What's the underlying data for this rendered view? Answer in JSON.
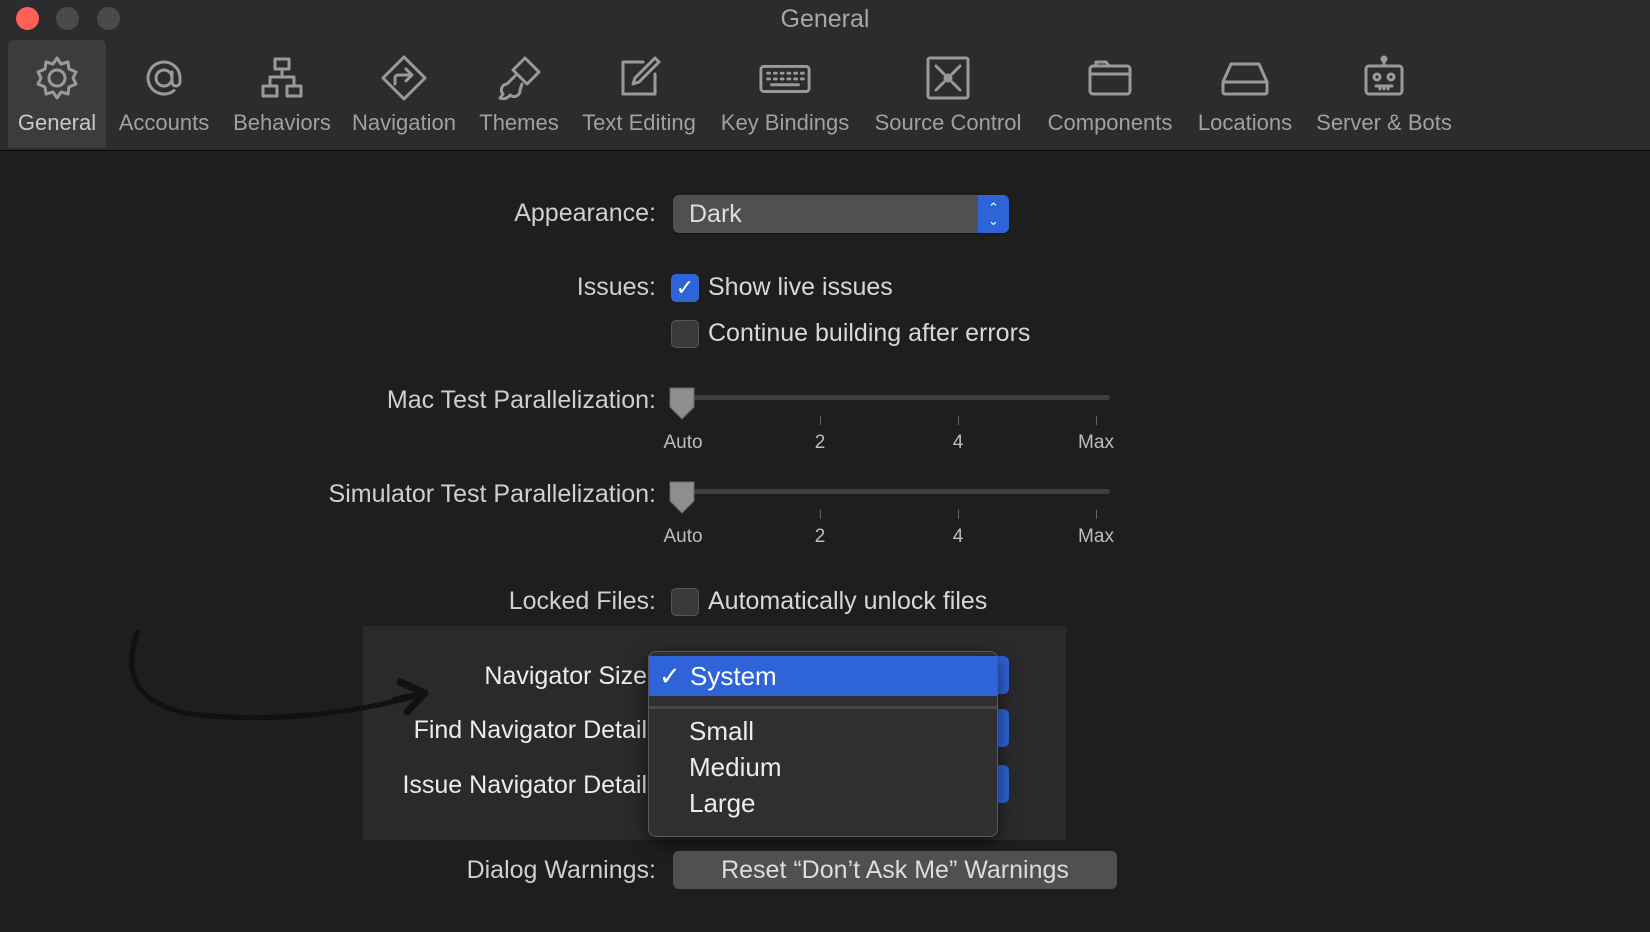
{
  "window": {
    "title": "General"
  },
  "toolbar": [
    {
      "label": "General",
      "icon": "gear-icon"
    },
    {
      "label": "Accounts",
      "icon": "at-sign-icon"
    },
    {
      "label": "Behaviors",
      "icon": "hierarchy-icon"
    },
    {
      "label": "Navigation",
      "icon": "navigation-diamond-icon"
    },
    {
      "label": "Themes",
      "icon": "paintbrush-icon"
    },
    {
      "label": "Text Editing",
      "icon": "pencil-square-icon"
    },
    {
      "label": "Key Bindings",
      "icon": "keyboard-icon"
    },
    {
      "label": "Source Control",
      "icon": "source-control-icon"
    },
    {
      "label": "Components",
      "icon": "folder-icon"
    },
    {
      "label": "Locations",
      "icon": "drive-icon"
    },
    {
      "label": "Server & Bots",
      "icon": "robot-icon"
    }
  ],
  "appearance": {
    "label": "Appearance:",
    "value": "Dark"
  },
  "issues": {
    "label": "Issues:",
    "show_live": {
      "text": "Show live issues",
      "checked": true
    },
    "continue_building": {
      "text": "Continue building after errors",
      "checked": false
    }
  },
  "mac_parallel": {
    "label": "Mac Test Parallelization:",
    "ticks": [
      "Auto",
      "2",
      "4",
      "Max"
    ],
    "value": "Auto"
  },
  "sim_parallel": {
    "label": "Simulator Test Parallelization:",
    "ticks": [
      "Auto",
      "2",
      "4",
      "Max"
    ],
    "value": "Auto"
  },
  "locked_files": {
    "label": "Locked Files:",
    "text": "Automatically unlock files",
    "checked": false
  },
  "navigator_size": {
    "label": "Navigator Size"
  },
  "find_navigator": {
    "label": "Find Navigator Detail"
  },
  "issue_navigator": {
    "label": "Issue Navigator Detail"
  },
  "menu": {
    "selected": "System",
    "check": "✓",
    "options": [
      "Small",
      "Medium",
      "Large"
    ]
  },
  "dialog_warnings": {
    "label": "Dialog Warnings:",
    "button": "Reset “Don’t Ask Me” Warnings"
  },
  "colors": {
    "accent": "#2e64d8",
    "background": "#1e1e1e",
    "close": "#ff5f57"
  }
}
